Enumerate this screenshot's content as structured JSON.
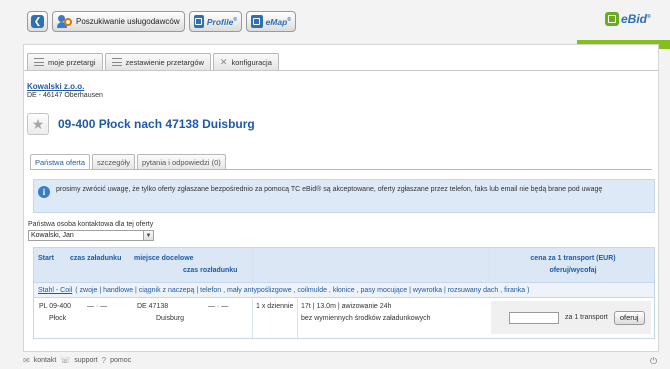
{
  "toolbar": {
    "back_icon": "back-arrow-icon",
    "search_label": "Poszukiwanie usługodawców",
    "profile_label": "Profile",
    "emap_label": "eMap",
    "brand_mark": "®"
  },
  "logo": {
    "text": "eBid",
    "mark": "®",
    "color": "#2f6fb3",
    "accent": "#85bf1e"
  },
  "tabs": [
    {
      "label": "moje przetargi",
      "icon": "list-icon"
    },
    {
      "label": "zestawienie przetargów",
      "icon": "list-icon"
    },
    {
      "label": "konfiguracja",
      "icon": "tools-icon"
    }
  ],
  "company": {
    "name": "Kowalski z.o.o.",
    "address": "DE - 46147 Oberhausen"
  },
  "offer": {
    "title": "09-400 Płock nach 47138 Duisburg"
  },
  "subtabs": [
    "Państwa oferta",
    "szczegóły",
    "pytania i odpowiedzi (0)"
  ],
  "info": {
    "text": "prosimy zwrócić uwagę, że tylko oferty zgłaszane bezpośrednio za pomocą TC eBid® są akceptowane, oferty zgłaszane przez telefon, faks lub email nie będą brane pod uwagę"
  },
  "contact": {
    "label": "Państwa osoba kontaktowa dla tej oferty",
    "value": "Kowalski, Jan"
  },
  "table": {
    "headers": {
      "start": "Start",
      "loading_time": "czas załadunku",
      "destination": "miejsce docelowe",
      "unloading_time": "czas rozładunku",
      "price": "cena za 1 transport (EUR)",
      "offer_withdraw": "oferuj/wycofaj"
    },
    "category": {
      "name": "Stahl - Coil",
      "details": "( zwoje | handlowe | ciągnik z naczepą | telefon , mały antypoślizgowe , coilmulde , kłonice , pasy mocujące | wywrotka | rozsuwany dach , firanka )"
    },
    "row": {
      "from_code": "PL 09-400",
      "from_city": "Płock",
      "from_time": "— · —",
      "to_code": "DE 47138",
      "to_city": "Duisburg",
      "to_time": "— · —",
      "frequency": "1 x dziennie",
      "spec_line1": "17t | 13.0m | awizowanie 24h",
      "spec_line2": "bez wymiennych środków załadunkowych",
      "price_value": "",
      "price_unit": "za 1 transport",
      "offer_button": "oferuj"
    }
  },
  "footer": {
    "contact": "kontakt",
    "support": "support",
    "help": "pomoc"
  }
}
